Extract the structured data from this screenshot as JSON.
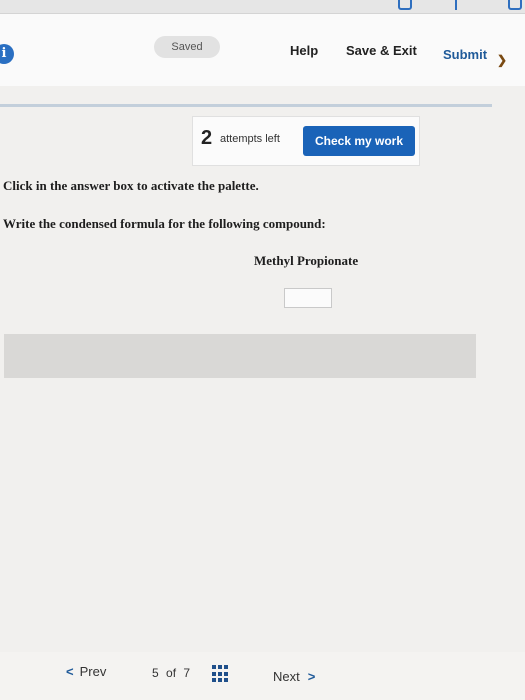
{
  "header": {
    "saved_label": "Saved",
    "help_label": "Help",
    "save_exit_label": "Save & Exit",
    "submit_label": "Submit"
  },
  "attempts": {
    "count": "2",
    "text": "attempts left",
    "check_label": "Check my work"
  },
  "question": {
    "instruction": "Click in the answer box to activate the palette.",
    "prompt": "Write the condensed formula for the following compound:",
    "compound": "Methyl Propionate"
  },
  "nav": {
    "prev_label": "Prev",
    "page_current": "5",
    "page_of": "of",
    "page_total": "7",
    "next_label": "Next"
  },
  "colors": {
    "accent": "#1a63b8",
    "info_icon": "#2a6fc2",
    "background": "#f1f0ee"
  }
}
